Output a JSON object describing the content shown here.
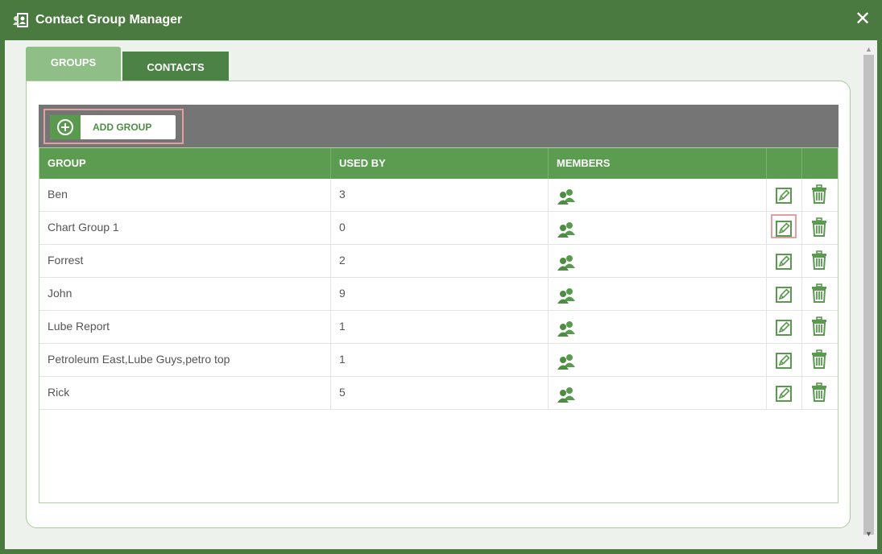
{
  "window": {
    "title": "Contact Group Manager",
    "close_symbol": "✕",
    "icon": "contacts-book-icon"
  },
  "tabs": [
    {
      "label": "GROUPS",
      "active": true
    },
    {
      "label": "CONTACTS",
      "active": false
    }
  ],
  "toolbar": {
    "add_group_label": "ADD GROUP",
    "add_icon": "plus-circle-icon"
  },
  "table": {
    "columns": [
      "GROUP",
      "USED BY",
      "MEMBERS",
      "",
      ""
    ],
    "rows": [
      {
        "group": "Ben",
        "used_by": "3"
      },
      {
        "group": "Chart Group 1",
        "used_by": "0"
      },
      {
        "group": "Forrest",
        "used_by": "2"
      },
      {
        "group": "John",
        "used_by": "9"
      },
      {
        "group": "Lube Report",
        "used_by": "1"
      },
      {
        "group": "Petroleum East,Lube Guys,petro top",
        "used_by": "1"
      },
      {
        "group": "Rick",
        "used_by": "5"
      }
    ],
    "row_icons": [
      "members-icon",
      "edit-icon",
      "trash-icon"
    ]
  },
  "colors": {
    "title_bar": "#4a7a3f",
    "header": "#5c9c50",
    "icon_green": "#5a9a4e",
    "highlight": "#e2a0a0"
  }
}
